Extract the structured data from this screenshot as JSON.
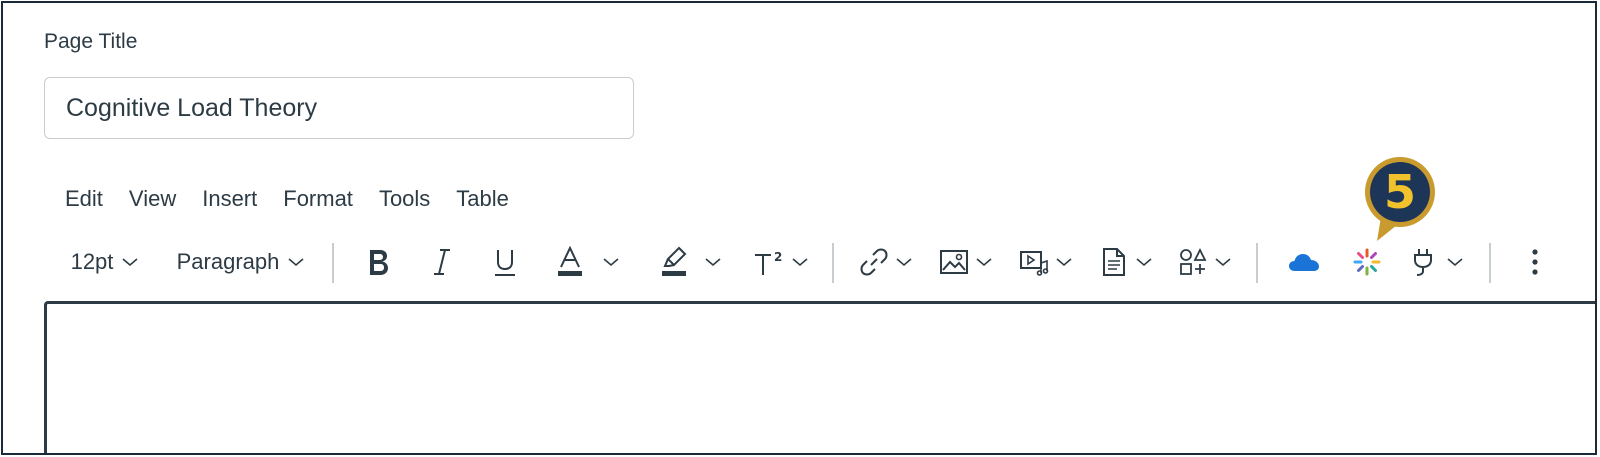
{
  "page_title_label": "Page Title",
  "title_input": {
    "value": "Cognitive Load Theory"
  },
  "menubar": [
    "Edit",
    "View",
    "Insert",
    "Format",
    "Tools",
    "Table"
  ],
  "toolbar": {
    "font_size": "12pt",
    "block_format": "Paragraph",
    "icons": [
      "bold-icon",
      "italic-icon",
      "underline-icon",
      "text-color-icon",
      "highlight-icon",
      "superscript-icon",
      "link-icon",
      "image-icon",
      "media-icon",
      "document-icon",
      "apps-icon",
      "onedrive-icon",
      "spark-icon",
      "plug-icon",
      "more-options-icon"
    ]
  },
  "callout": {
    "number": "5"
  },
  "colors": {
    "text": "#2d3b45",
    "border": "#c7cdd1",
    "callout_fill": "#1d3557",
    "callout_ring": "#c99a2e",
    "callout_text": "#f2c22d",
    "onedrive_blue": "#1a73d6"
  }
}
